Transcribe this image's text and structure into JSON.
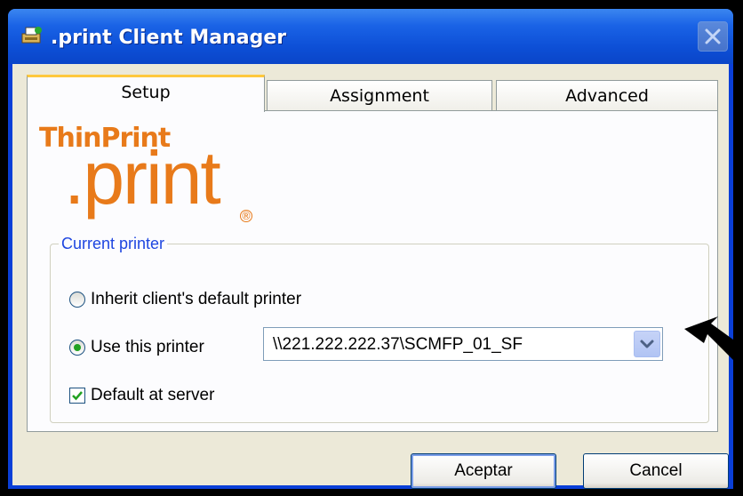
{
  "window": {
    "title": ".print Client Manager"
  },
  "tabs": [
    {
      "label": "Setup",
      "active": true
    },
    {
      "label": "Assignment",
      "active": false
    },
    {
      "label": "Advanced",
      "active": false
    }
  ],
  "logo": {
    "brand": "ThinPrint",
    "product": ".print",
    "registered": "®"
  },
  "group": {
    "label": "Current printer",
    "option_inherit": {
      "label": "Inherit client's default printer",
      "selected": false
    },
    "option_use": {
      "label": "Use this printer",
      "selected": true
    },
    "printer_value": "\\\\221.222.222.37\\SCMFP_01_SF",
    "default_at_server": {
      "label": "Default at server",
      "checked": true
    }
  },
  "buttons": {
    "ok_label": "Aceptar",
    "cancel_label": "Cancel"
  },
  "colors": {
    "accent": "#e87a1a",
    "titlebar": "#0a45c8",
    "group_label": "#1e46e0"
  },
  "icons": {
    "app": "printer-app-icon",
    "close": "close-icon",
    "dropdown": "chevron-down-icon"
  }
}
